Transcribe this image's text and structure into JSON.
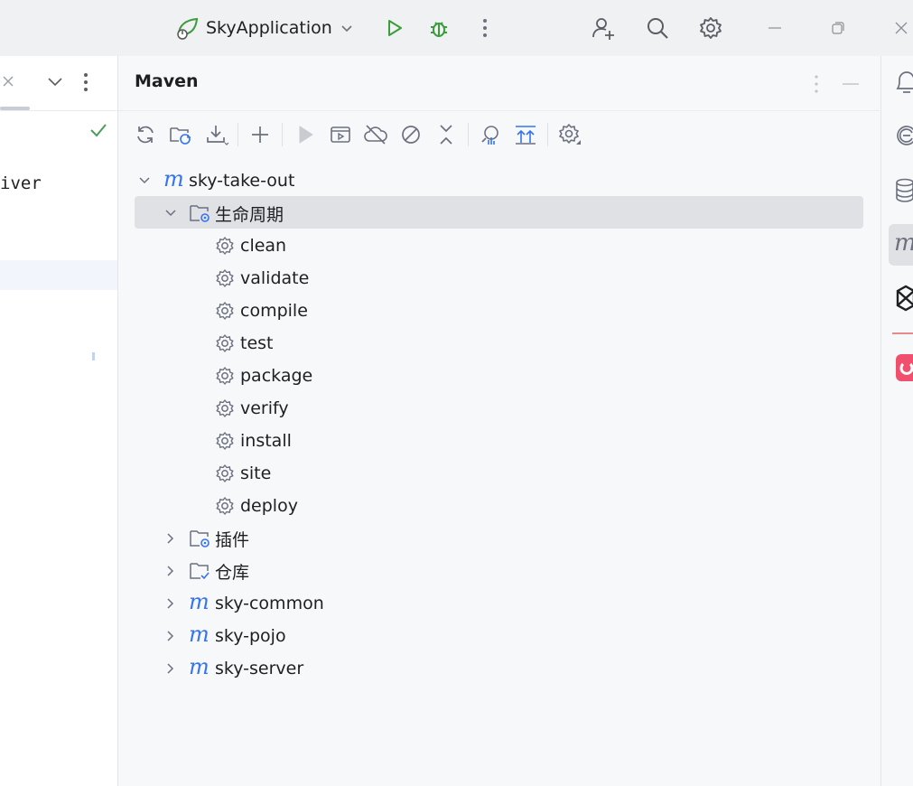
{
  "titlebar": {
    "run_config": "SkyApplication",
    "icons": [
      "spring-boot-icon",
      "chevron-down-icon",
      "run-icon",
      "debug-icon",
      "more-vertical-icon",
      "add-user-icon",
      "search-icon",
      "settings-icon",
      "minimize-icon",
      "restore-icon",
      "close-icon"
    ]
  },
  "left_panel": {
    "partial_code_text": "iver"
  },
  "maven": {
    "title": "Maven",
    "toolbar": [
      "reload-icon",
      "reload-folder-icon",
      "download-icon",
      "add-icon",
      "run-icon",
      "run-config-icon",
      "offline-icon",
      "skip-tests-icon",
      "collapse-icon",
      "analyze-icon",
      "show-dependencies-icon",
      "settings-icon"
    ],
    "tree": {
      "root": "sky-take-out",
      "lifecycle_label": "生命周期",
      "lifecycle": [
        "clean",
        "validate",
        "compile",
        "test",
        "package",
        "verify",
        "install",
        "site",
        "deploy"
      ],
      "plugins_label": "插件",
      "repos_label": "仓库",
      "modules": [
        "sky-common",
        "sky-pojo",
        "sky-server"
      ]
    }
  },
  "colors": {
    "accent": "#3574f0",
    "run_green": "#3a9c3a",
    "selection": "#dfe1e5"
  }
}
